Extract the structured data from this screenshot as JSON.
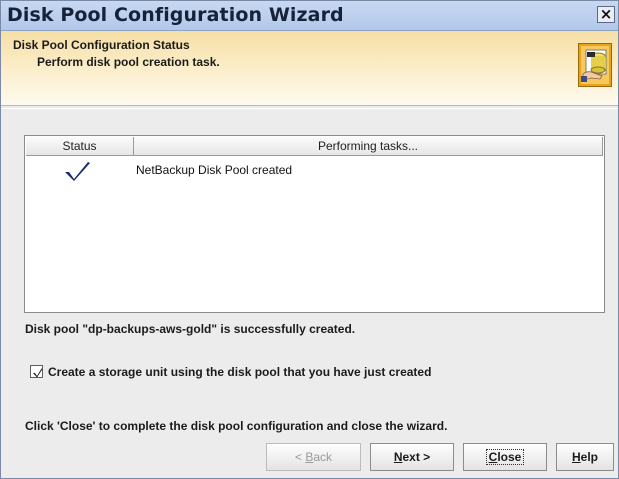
{
  "window": {
    "title": "Disk Pool Configuration Wizard",
    "close_glyph": "×"
  },
  "header": {
    "title": "Disk Pool Configuration Status",
    "subtitle": "Perform disk pool creation task.",
    "icon": "disk-pool-wizard-icon"
  },
  "table": {
    "columns": [
      "Status",
      "Performing tasks..."
    ],
    "rows": [
      {
        "status": "check-icon",
        "task": "NetBackup Disk Pool created"
      }
    ]
  },
  "result_message": "Disk pool \"dp-backups-aws-gold\" is successfully created.",
  "storage_unit_checkbox": {
    "checked": true,
    "label": "Create a storage unit using the disk pool that you have just created"
  },
  "footer_message": "Click 'Close' to complete the disk pool configuration and close the wizard.",
  "buttons": {
    "back": {
      "mnemonic": "B",
      "rest": "ack",
      "prefix": "< ",
      "enabled": false
    },
    "next": {
      "mnemonic": "N",
      "rest": "ext >",
      "enabled": true
    },
    "close": {
      "mnemonic": "C",
      "rest": "lose",
      "enabled": true
    },
    "help": {
      "mnemonic": "H",
      "rest": "elp",
      "enabled": true
    }
  },
  "colors": {
    "title_bar": "#b3c8ea",
    "header_gradient_top": "#f6dfa6",
    "check_mark": "#1a2a6e"
  }
}
